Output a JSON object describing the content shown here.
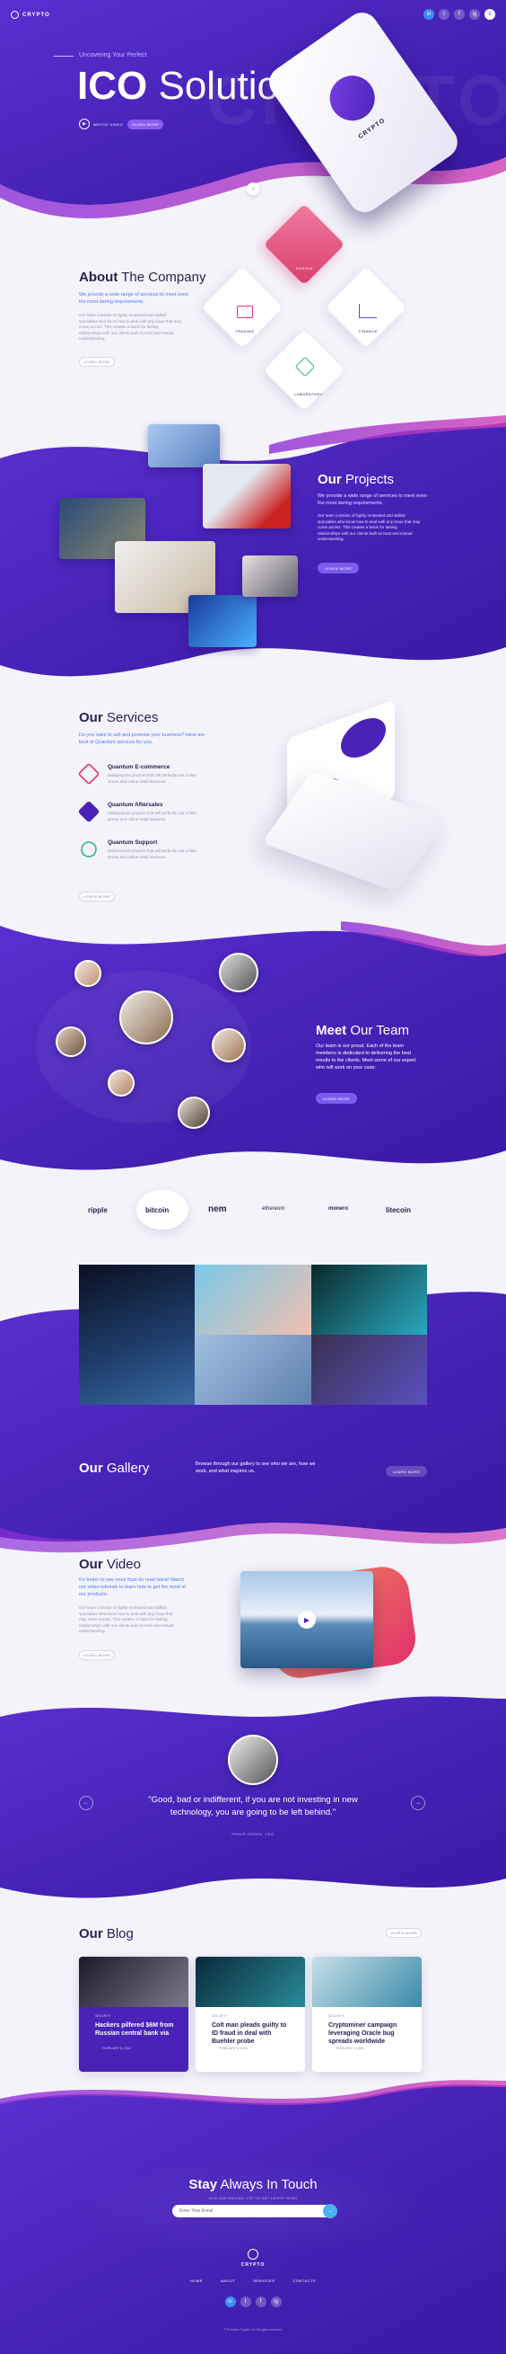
{
  "header": {
    "logo": "CRYPTO",
    "social": [
      "in",
      "t",
      "f",
      "ig"
    ]
  },
  "hero": {
    "eyebrow": "Uncovering Your Perfect",
    "title_bold": "ICO",
    "title_light": "Solution",
    "video_label": "WATCH VIDEO",
    "cta": "LEARN MORE",
    "phone_label": "CRYPTO"
  },
  "about": {
    "title_bold": "About",
    "title_light": "The Company",
    "lead": "We provide a wide range of services to meet even the most daring requirements.",
    "body": "Our team consists of highly motivated and skilled specialists who know how to deal with any issue that may come across. This creates a basis for lasting relationships with our clients built on trust and mutual understanding.",
    "cta": "LEARN MORE",
    "diamonds": [
      "DESIGN",
      "FINANCE",
      "TRADING",
      "LABORATORY"
    ]
  },
  "projects": {
    "title_bold": "Our",
    "title_light": "Projects",
    "lead": "We provide a wide range of services to meet even the most daring requirements.",
    "body": "Our team consists of highly motivated and skilled specialists who know how to deal with any issue that may come across. This creates a basis for lasting relationships with our clients built on trust and mutual understanding.",
    "cta": "LEARN MORE"
  },
  "services": {
    "title_bold": "Our",
    "title_light": "Services",
    "lead": "Do you want to sell and promote your business? Here are best of Quantum services for you.",
    "items": [
      {
        "title": "Quantum E-commerce",
        "desc": "Multipurpose projects that will perfectly suit online stores and online retail business."
      },
      {
        "title": "Quantum Aftersales",
        "desc": "Multipurpose projects that will perfectly suit online stores and online retail business."
      },
      {
        "title": "Quantum Support",
        "desc": "Multipurpose projects that will perfectly suit online stores and online retail business."
      }
    ],
    "cta": "LEARN MORE"
  },
  "team": {
    "title_bold": "Meet",
    "title_light": "Our Team",
    "body": "Our team is our proud. Each of the team members is dedicated to delivering the best results to the clients. Meet some of our expert who will work on your case:",
    "cta": "LEARN MORE"
  },
  "partners": [
    "ripple",
    "bitcoin",
    "nem",
    "ethereum",
    "monero",
    "litecoin"
  ],
  "gallery": {
    "title_bold": "Our",
    "title_light": "Gallery",
    "body": "Browse through our gallery to see who we are, how we work, and what inspires us.",
    "cta": "LEARN MORE"
  },
  "video": {
    "title_bold": "Our",
    "title_light": "Video",
    "lead": "It's better to see once than do read twice! Watch our video tutorials to learn how to get the most of our products.",
    "body": "Our team consists of highly motivated and skilled specialists who know how to deal with any issue that may come across. This creates a basis for lasting relationships with our clients built on trust and mutual understanding.",
    "cta": "LEARN MORE"
  },
  "testimonial": {
    "quote": "\"Good, bad or indifferent, if you are not investing in new technology, you are going to be left behind.\"",
    "author": "PHILIP GREEN, CEO"
  },
  "blog": {
    "title_bold": "Our",
    "title_light": "Blog",
    "cta": "LEARN MORE",
    "posts": [
      {
        "tag": "SECURITY",
        "title": "Hackers pilfered $6M from Russian central bank via",
        "date": "FEBRUARY 5, 2018"
      },
      {
        "tag": "SECURITY",
        "title": "Colt man pleads guilty to ID fraud in deal with Buehler probe",
        "date": "FEBRUARY 5, 2018"
      },
      {
        "tag": "SECURITY",
        "title": "Cryptominer campaign leveraging Oracle bug spreads worldwide",
        "date": "FEBRUARY 5, 2018"
      }
    ]
  },
  "footer": {
    "title_bold": "Stay",
    "title_light": "Always In Touch",
    "subtitle": "JOIN OUR MAILING LIST TO GET LATEST NEWS",
    "email_placeholder": "Enter Your Email",
    "logo": "CRYPTO",
    "nav": [
      "HOME",
      "ABOUT",
      "SERVICES",
      "CONTACTS"
    ],
    "copyright": "© Premium Crypto Co. All rights reserved."
  },
  "colors": {
    "primary": "#4a22b8",
    "accent": "#7b3fe4",
    "pink": "#ec4f8e",
    "blue": "#4e7cf5"
  }
}
